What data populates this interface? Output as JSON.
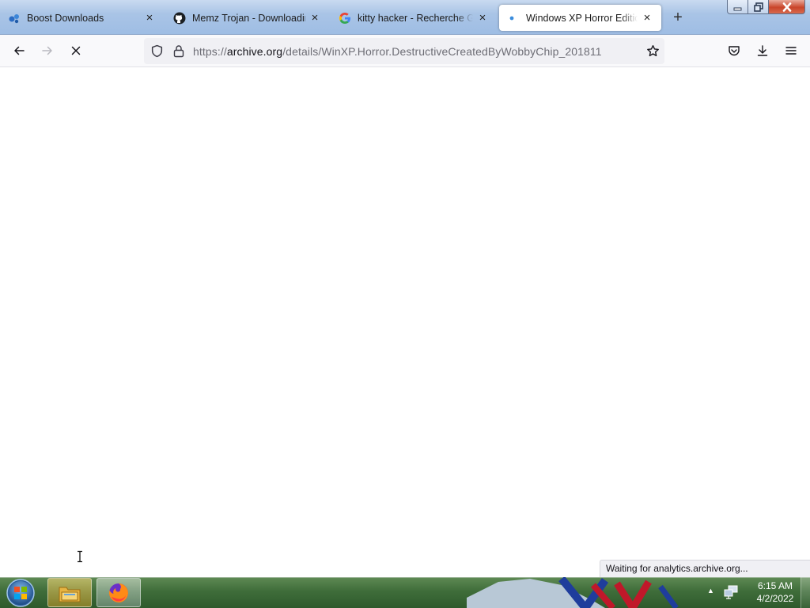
{
  "browser": {
    "tabs": [
      {
        "title": "Boost Downloads",
        "favicon": "boost-icon",
        "close": "×"
      },
      {
        "title": "Memz Trojan - Downloading",
        "favicon": "github-icon",
        "close": "×"
      },
      {
        "title": "kitty hacker - Recherche Google",
        "favicon": "google-icon",
        "close": "×"
      },
      {
        "title": "Windows XP Horror Edition (",
        "favicon": "loading-dot-icon",
        "close": "×",
        "active": true
      }
    ],
    "new_tab_label": "+",
    "url": {
      "prefix": "https://",
      "host": "archive.org",
      "path": "/details/WinXP.Horror.DestructiveCreatedByWobbyChip_201811"
    },
    "status_text": "Waiting for analytics.archive.org..."
  },
  "taskbar": {
    "time": "6:15 AM",
    "date": "4/2/2022",
    "tray_arrow": "▲"
  },
  "colors": {
    "accent": "#0060df",
    "taskbar": "#3f6d3a",
    "tab_strip": "#a9c4e6"
  }
}
